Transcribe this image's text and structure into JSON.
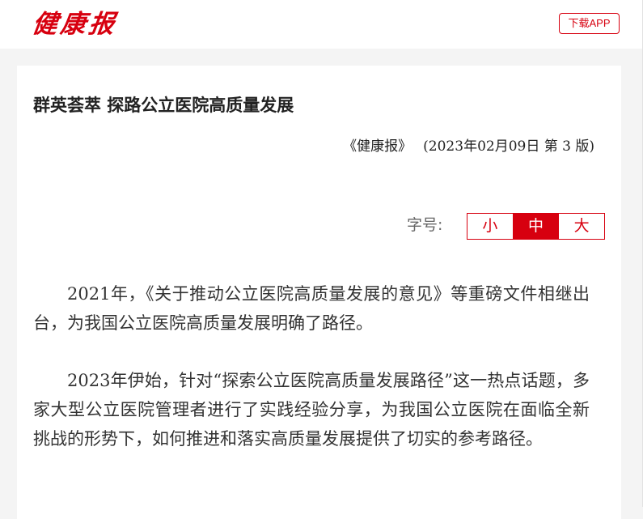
{
  "header": {
    "logo_text": "健康报",
    "download_label": "下载APP"
  },
  "article": {
    "title": "群英荟萃 探路公立医院高质量发展",
    "source_name": "《健康报》",
    "source_meta": "(2023年02月09日 第 3 版)",
    "paragraphs": [
      "2021年，《关于推动公立医院高质量发展的意见》等重磅文件相继出台，为我国公立医院高质量发展明确了路径。",
      "2023年伊始，针对“探索公立医院高质量发展路径”这一热点话题，多家大型公立医院管理者进行了实践经验分享，为我国公立医院在面临全新挑战的形势下，如何推进和落实高质量发展提供了切实的参考路径。"
    ]
  },
  "font_size_control": {
    "label": "字号:",
    "options": [
      "小",
      "中",
      "大"
    ],
    "selected": "中"
  },
  "colors": {
    "brand_red": "#d7000f",
    "background": "#f4f4f4",
    "card": "#ffffff"
  }
}
